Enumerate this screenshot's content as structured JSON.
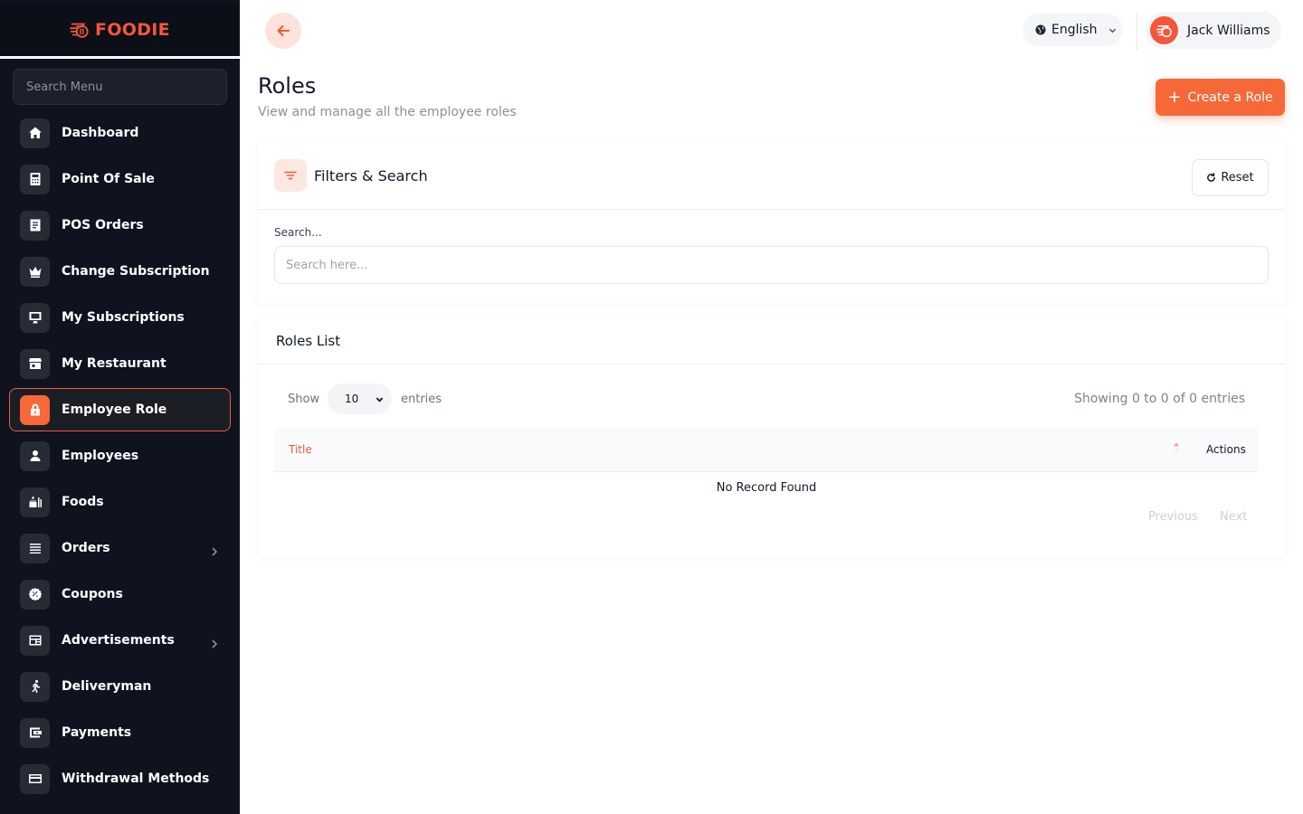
{
  "brand": {
    "name": "FOODIE",
    "color": "#f5563a"
  },
  "sidebar": {
    "search_placeholder": "Search Menu",
    "items": [
      {
        "label": "Dashboard",
        "icon": "home-icon"
      },
      {
        "label": "Point Of Sale",
        "icon": "calculator-icon"
      },
      {
        "label": "POS Orders",
        "icon": "receipt-icon"
      },
      {
        "label": "Change Subscription",
        "icon": "crown-icon"
      },
      {
        "label": "My Subscriptions",
        "icon": "monitor-icon"
      },
      {
        "label": "My Restaurant",
        "icon": "store-icon"
      },
      {
        "label": "Employee Role",
        "icon": "lock-icon",
        "active": true
      },
      {
        "label": "Employees",
        "icon": "user-icon"
      },
      {
        "label": "Foods",
        "icon": "food-icon"
      },
      {
        "label": "Orders",
        "icon": "list-icon",
        "expandable": true
      },
      {
        "label": "Coupons",
        "icon": "badge-icon"
      },
      {
        "label": "Advertisements",
        "icon": "billboard-icon",
        "expandable": true
      },
      {
        "label": "Deliveryman",
        "icon": "runner-icon"
      },
      {
        "label": "Payments",
        "icon": "wallet-icon"
      },
      {
        "label": "Withdrawal Methods",
        "icon": "credit-card-icon"
      }
    ]
  },
  "topbar": {
    "language": "English",
    "user_name": "Jack Williams"
  },
  "header": {
    "title": "Roles",
    "subtitle": "View and manage all the employee roles",
    "create_button": "Create a Role"
  },
  "filters": {
    "title": "Filters & Search",
    "reset_label": "Reset",
    "search_label": "Search...",
    "search_placeholder": "Search here...",
    "search_value": ""
  },
  "roles_list": {
    "title": "Roles List",
    "show_label": "Show",
    "entries_value": "10",
    "entries_label": "entries",
    "showing_text": "Showing 0 to 0 of 0 entries",
    "columns": [
      "Title",
      "Actions"
    ],
    "rows": [],
    "empty_text": "No Record Found",
    "previous_label": "Previous",
    "next_label": "Next"
  },
  "colors": {
    "accent": "#f76839",
    "sidebar_bg": "#0e131f"
  }
}
